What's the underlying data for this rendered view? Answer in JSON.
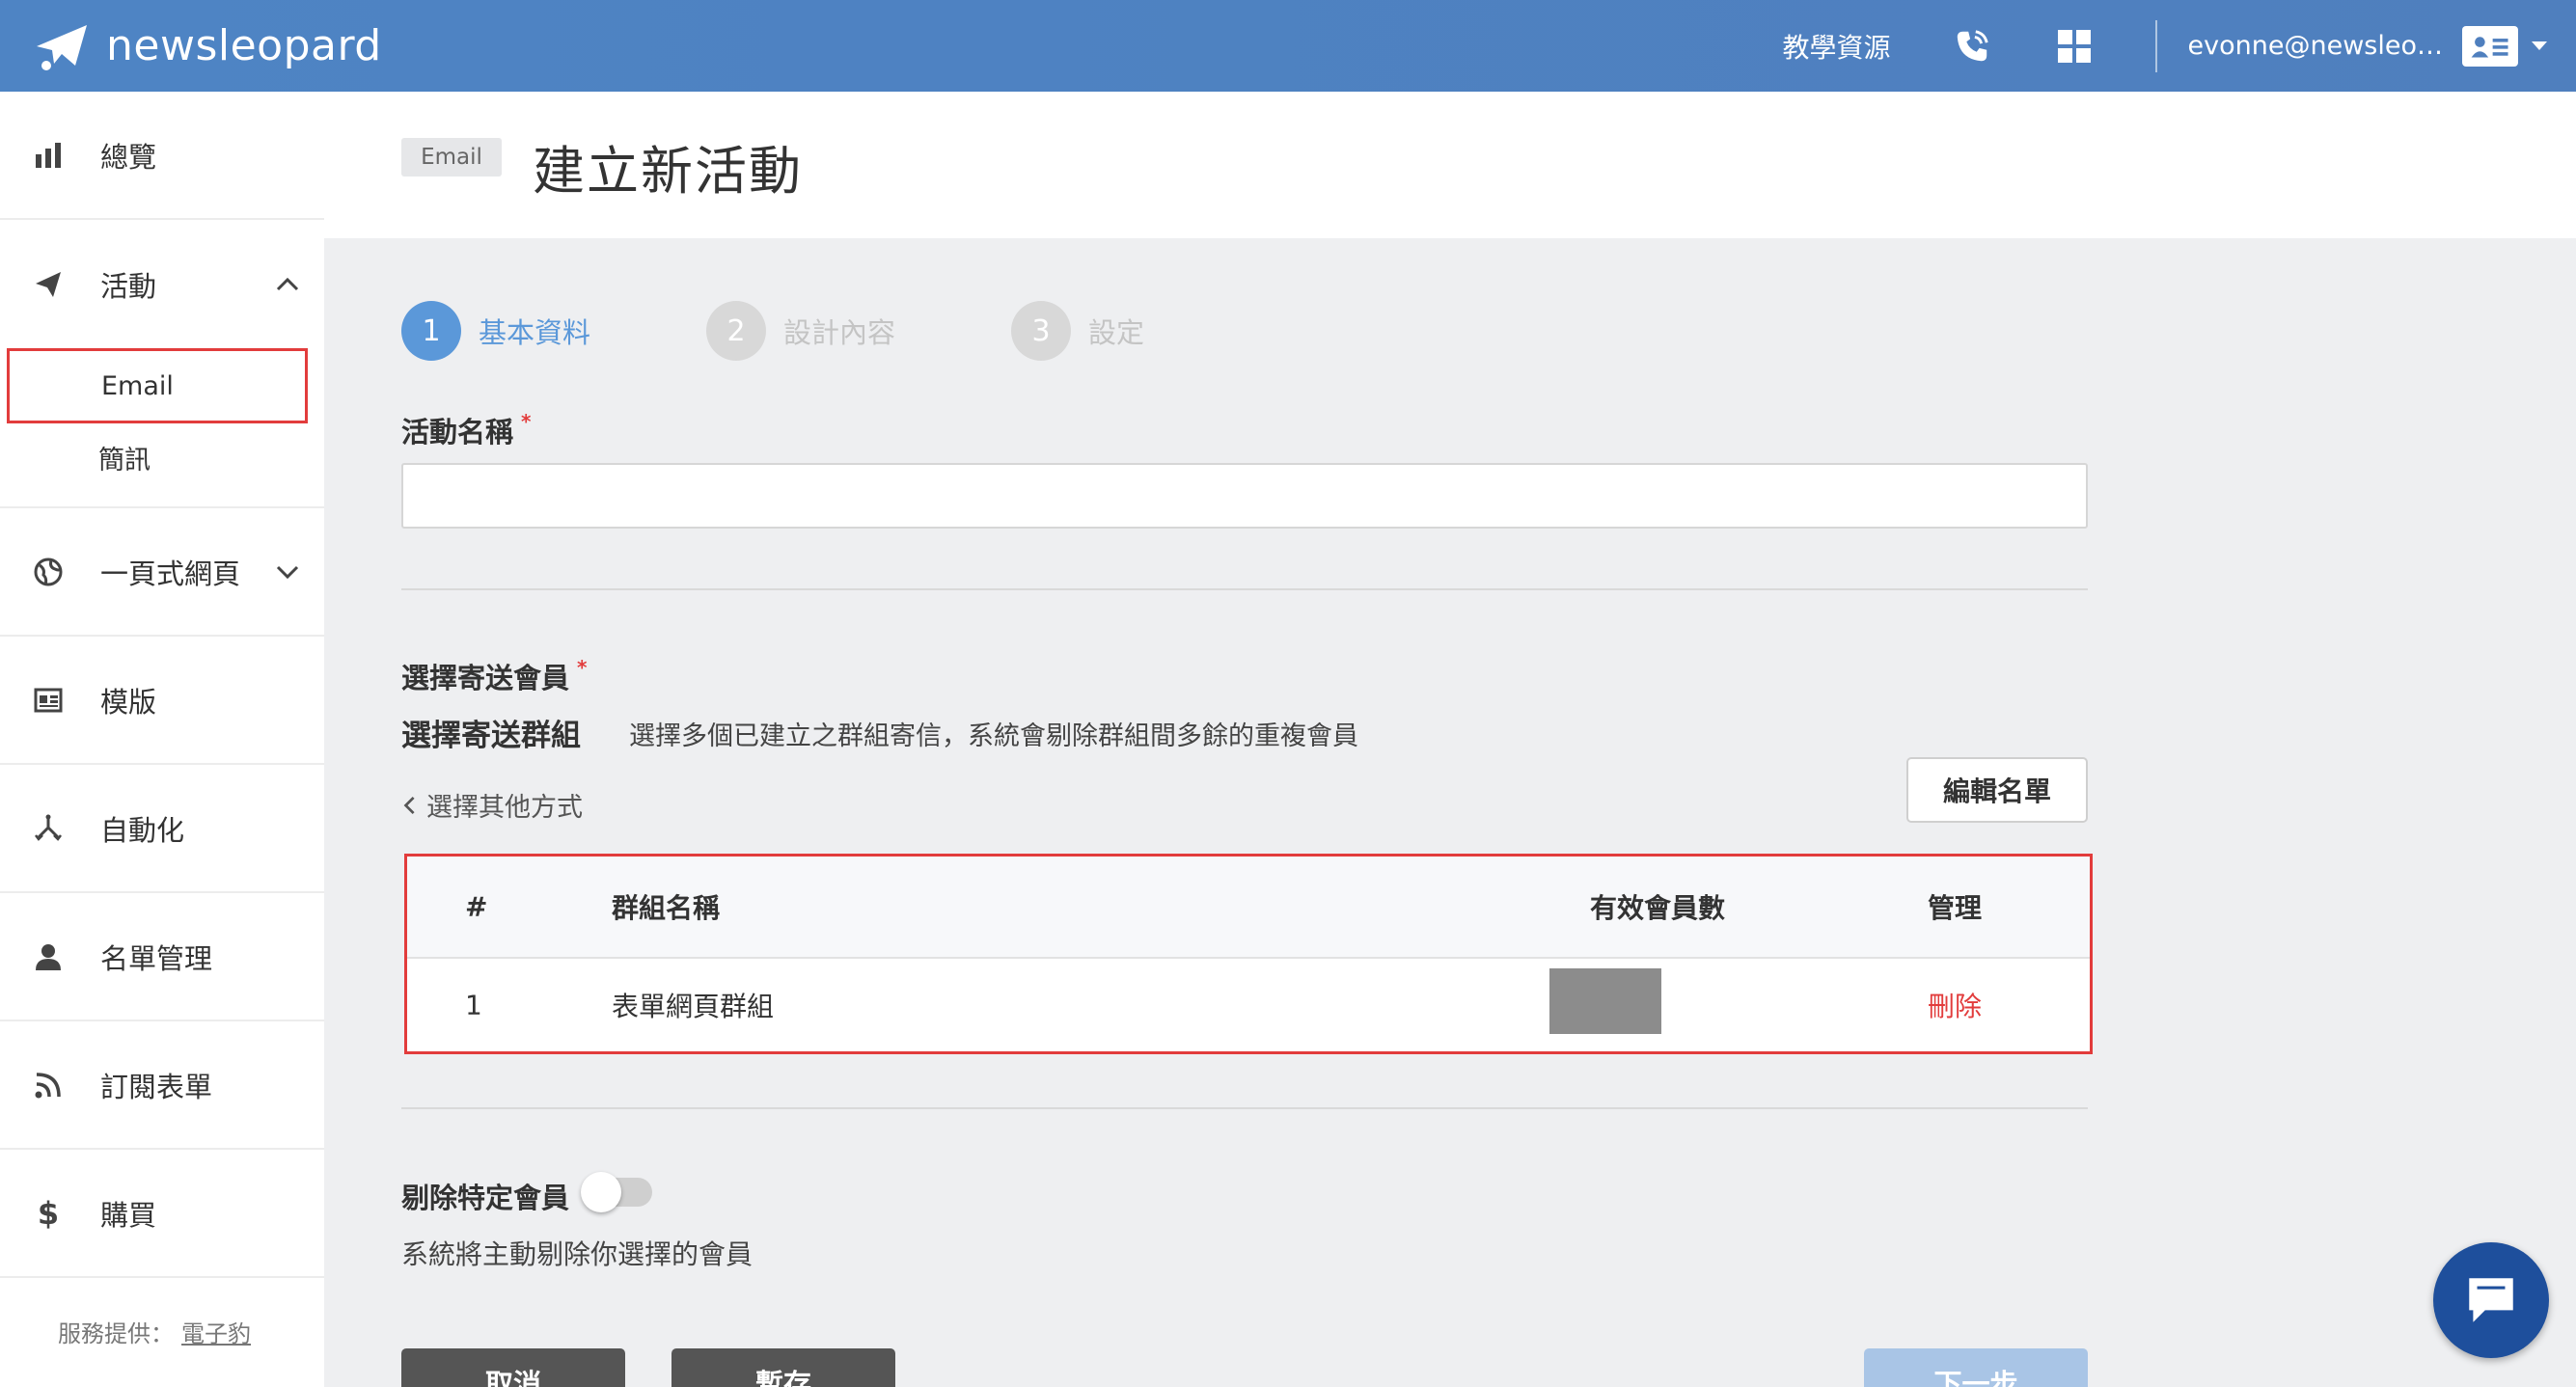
{
  "header": {
    "logo_text": "newsleopard",
    "resources_label": "教學資源",
    "user_email": "evonne@newsleo…",
    "icons": [
      "phone-icon",
      "grid-icon",
      "id-card-icon"
    ]
  },
  "sidebar": {
    "items": [
      {
        "label": "總覽",
        "icon": "bar-chart-icon"
      },
      {
        "label": "活動",
        "icon": "paper-plane-icon"
      },
      {
        "label": "一頁式網頁",
        "icon": "globe-icon"
      },
      {
        "label": "模版",
        "icon": "template-icon"
      },
      {
        "label": "自動化",
        "icon": "automation-icon"
      },
      {
        "label": "名單管理",
        "icon": "user-icon"
      },
      {
        "label": "訂閱表單",
        "icon": "rss-icon"
      },
      {
        "label": "購買",
        "icon": "dollar-icon"
      }
    ],
    "sub_items": [
      {
        "label": "Email"
      },
      {
        "label": "簡訊"
      }
    ],
    "footer_prefix": "服務提供：",
    "footer_link": "電子豹"
  },
  "main": {
    "tag": "Email",
    "title": "建立新活動",
    "steps": [
      {
        "num": "1",
        "label": "基本資料"
      },
      {
        "num": "2",
        "label": "設計內容"
      },
      {
        "num": "3",
        "label": "設定"
      }
    ],
    "campaign_name_label": "活動名稱",
    "required_mark": "*",
    "campaign_name_value": "",
    "select_members_label": "選擇寄送會員",
    "select_group_title": "選擇寄送群組",
    "select_group_desc": "選擇多個已建立之群組寄信，系統會剔除群組間多餘的重複會員",
    "other_way_link": "選擇其他方式",
    "edit_list_button": "編輯名單",
    "table": {
      "headers": [
        "#",
        "群組名稱",
        "有效會員數",
        "管理"
      ],
      "rows": [
        {
          "index": "1",
          "name": "表單網頁群組",
          "count": "",
          "action": "刪除"
        }
      ]
    },
    "exclude_label": "剔除特定會員",
    "exclude_desc": "系統將主動剔除你選擇的會員",
    "cancel_button": "取消",
    "save_button": "暫存",
    "next_button": "下一步"
  },
  "colors": {
    "header_bg": "#4f82c2",
    "accent": "#5b98d9",
    "danger": "#e23c3c",
    "chat": "#1e4f9c"
  }
}
